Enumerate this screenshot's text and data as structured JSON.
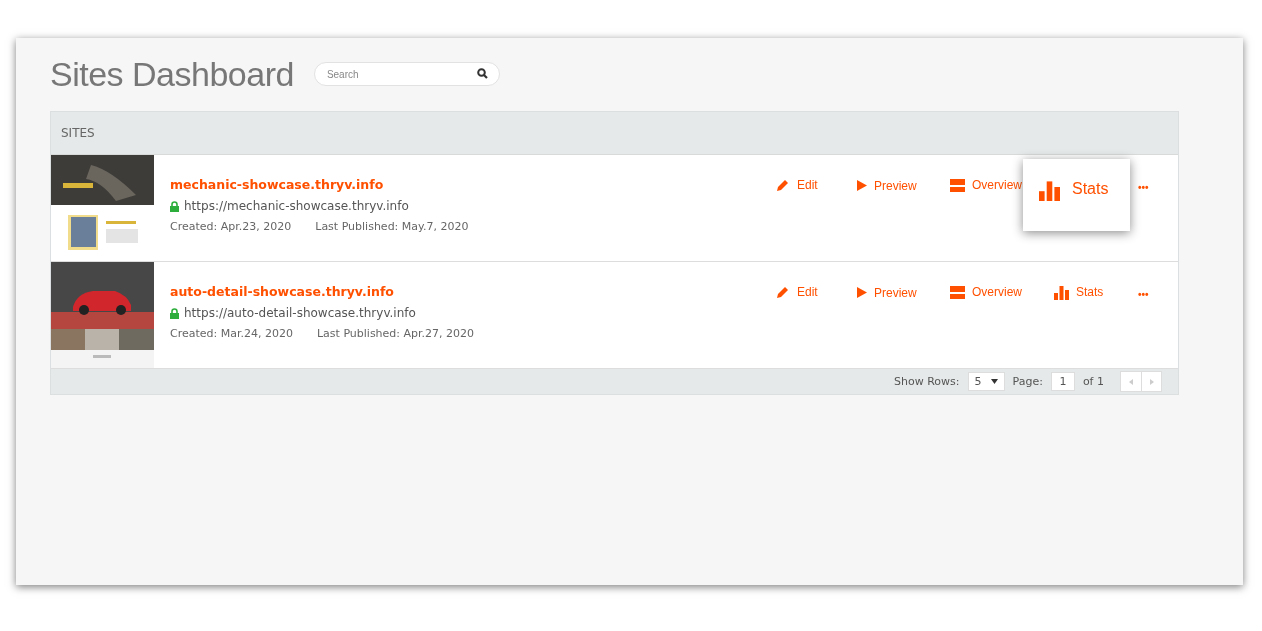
{
  "title": "Sites Dashboard",
  "search": {
    "placeholder": "Search"
  },
  "table": {
    "header": "SITES",
    "rows": [
      {
        "name": "mechanic-showcase.thryv.info",
        "url": "https://mechanic-showcase.thryv.info",
        "created": "Created: Apr.23, 2020",
        "published": "Last Published: May.7, 2020",
        "actions": [
          {
            "kind": "edit",
            "label": "Edit",
            "highlighted": false
          },
          {
            "kind": "preview",
            "label": "Preview",
            "highlighted": false
          },
          {
            "kind": "overview",
            "label": "Overview",
            "highlighted": false
          },
          {
            "kind": "stats",
            "label": "Stats",
            "highlighted": true
          },
          {
            "kind": "more",
            "label": "•••",
            "highlighted": false
          }
        ]
      },
      {
        "name": "auto-detail-showcase.thryv.info",
        "url": "https://auto-detail-showcase.thryv.info",
        "created": "Created: Mar.24, 2020",
        "published": "Last Published: Apr.27, 2020",
        "actions": [
          {
            "kind": "edit",
            "label": "Edit",
            "highlighted": false
          },
          {
            "kind": "preview",
            "label": "Preview",
            "highlighted": false
          },
          {
            "kind": "overview",
            "label": "Overview",
            "highlighted": false
          },
          {
            "kind": "stats",
            "label": "Stats",
            "highlighted": false
          },
          {
            "kind": "more",
            "label": "•••",
            "highlighted": false
          }
        ]
      }
    ]
  },
  "footer": {
    "rows_label": "Show Rows:",
    "rows_value": "5",
    "page_label": "Page:",
    "page_value": "1",
    "page_total": "of 1"
  }
}
